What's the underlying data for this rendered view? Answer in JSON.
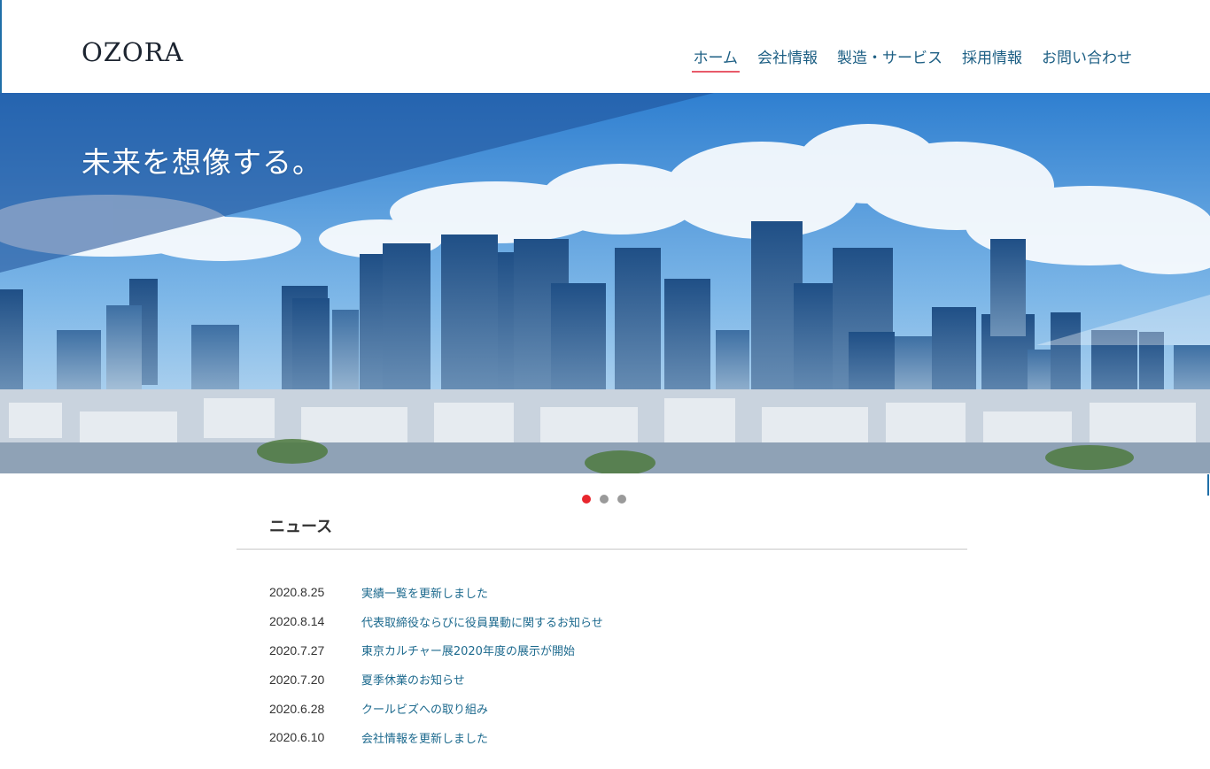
{
  "header": {
    "logo": "OZORA",
    "nav": [
      {
        "label": "ホーム",
        "active": true
      },
      {
        "label": "会社情報",
        "active": false
      },
      {
        "label": "製造・サービス",
        "active": false
      },
      {
        "label": "採用情報",
        "active": false
      },
      {
        "label": "お問い合わせ",
        "active": false
      }
    ]
  },
  "hero": {
    "copy": "未来を想像する。",
    "slides_count": 3,
    "active_slide": 1
  },
  "news": {
    "title": "ニュース",
    "items": [
      {
        "date": "2020.8.25",
        "title": "実績一覧を更新しました"
      },
      {
        "date": "2020.8.14",
        "title": "代表取締役ならびに役員異動に関するお知らせ"
      },
      {
        "date": "2020.7.27",
        "title": "東京カルチャー展2020年度の展示が開始"
      },
      {
        "date": "2020.7.20",
        "title": "夏季休業のお知らせ"
      },
      {
        "date": "2020.6.28",
        "title": "クールビズへの取り組み"
      },
      {
        "date": "2020.6.10",
        "title": "会社情報を更新しました"
      }
    ]
  },
  "colors": {
    "accent_red": "#e8262d",
    "link_blue": "#1d6a8e",
    "nav_blue": "#1d5f84"
  }
}
